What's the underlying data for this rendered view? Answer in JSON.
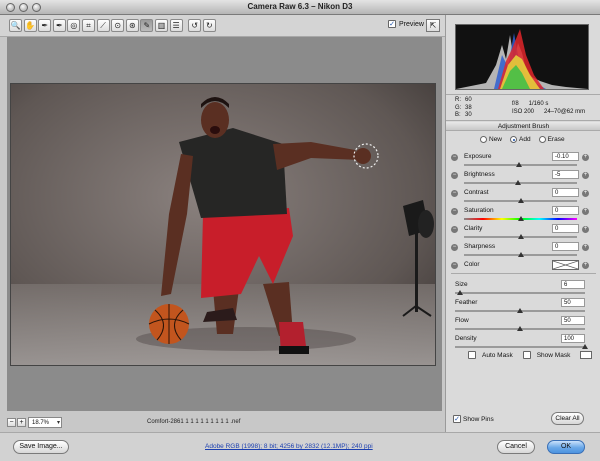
{
  "window": {
    "title": "Camera Raw 6.3  –  Nikon D3"
  },
  "toolbar": {
    "tools": [
      {
        "name": "zoom-tool",
        "icon": "magnifier-icon",
        "glyph": "🔍"
      },
      {
        "name": "hand-tool",
        "icon": "hand-icon",
        "glyph": "✋"
      },
      {
        "name": "white-balance-tool",
        "icon": "eyedropper-icon",
        "glyph": "✒"
      },
      {
        "name": "color-sampler-tool",
        "icon": "sampler-icon",
        "glyph": "✒"
      },
      {
        "name": "targeted-adjustment-tool",
        "icon": "target-icon",
        "glyph": "◎"
      },
      {
        "name": "crop-tool",
        "icon": "crop-icon",
        "glyph": "⌗"
      },
      {
        "name": "straighten-tool",
        "icon": "level-icon",
        "glyph": "⟋"
      },
      {
        "name": "spot-removal-tool",
        "icon": "spot-icon",
        "glyph": "⊙"
      },
      {
        "name": "red-eye-tool",
        "icon": "eye-icon",
        "glyph": "⊛"
      },
      {
        "name": "adjustment-brush-tool",
        "icon": "brush-icon",
        "glyph": "✎"
      },
      {
        "name": "graduated-filter-tool",
        "icon": "gradient-icon",
        "glyph": "▥"
      },
      {
        "name": "preferences-tool",
        "icon": "list-icon",
        "glyph": "☰"
      },
      {
        "name": "rotate-ccw-tool",
        "icon": "rotate-left-icon",
        "glyph": "↺"
      },
      {
        "name": "rotate-cw-tool",
        "icon": "rotate-right-icon",
        "glyph": "↻"
      }
    ],
    "preview_label": "Preview",
    "preview_checked": true
  },
  "readout": {
    "r_label": "R:",
    "r": "60",
    "g_label": "G:",
    "g": "38",
    "b_label": "B:",
    "b": "30",
    "aperture": "f/8",
    "shutter": "1/160 s",
    "iso": "ISO 200",
    "lens": "24–70@62 mm"
  },
  "panel": {
    "title": "Adjustment Brush",
    "modes": [
      "New",
      "Add",
      "Erase"
    ],
    "selected_mode": "Add",
    "adjustments": [
      {
        "label": "Exposure",
        "value": "-0.10",
        "level": 0.49
      },
      {
        "label": "Brightness",
        "value": "-5",
        "level": 0.48
      },
      {
        "label": "Contrast",
        "value": "0",
        "level": 0.5
      },
      {
        "label": "Saturation",
        "value": "0",
        "level": 0.5
      },
      {
        "label": "Clarity",
        "value": "0",
        "level": 0.5
      },
      {
        "label": "Sharpness",
        "value": "0",
        "level": 0.5
      },
      {
        "label": "Color",
        "value": "",
        "level": null
      }
    ],
    "brush": [
      {
        "label": "Size",
        "value": "6",
        "level": 0.04
      },
      {
        "label": "Feather",
        "value": "50",
        "level": 0.5
      },
      {
        "label": "Flow",
        "value": "50",
        "level": 0.5
      },
      {
        "label": "Density",
        "value": "100",
        "level": 1.0
      }
    ],
    "auto_mask_label": "Auto Mask",
    "show_mask_label": "Show Mask",
    "show_pins_label": "Show Pins",
    "show_pins_checked": true,
    "clear_all_label": "Clear All"
  },
  "status": {
    "zoom": "18.7%",
    "filename": "Comfort-2861 1 1 1 1 1 1 1 1 1 .nef"
  },
  "footer": {
    "save_label": "Save Image...",
    "workflow": "Adobe RGB (1998); 8 bit; 4256 by 2832 (12.1MP); 240 ppi",
    "cancel_label": "Cancel",
    "ok_label": "OK"
  }
}
